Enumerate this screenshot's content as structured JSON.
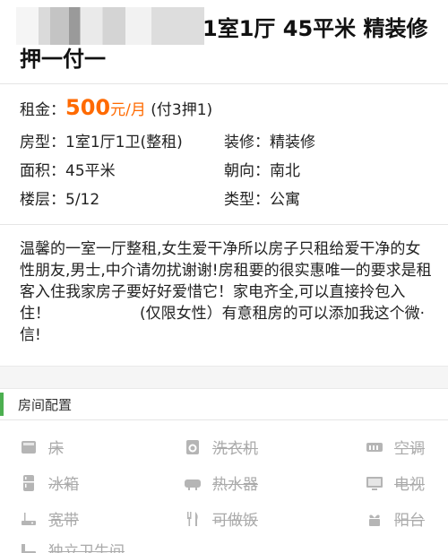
{
  "title": {
    "line1_visible": "1室1厅 45平米 精装修",
    "line2": "押一付一"
  },
  "price": {
    "label": "租金：",
    "amount": "500",
    "unit": "元/月",
    "terms": " (付3押1)"
  },
  "details": {
    "layout_label": "房型：",
    "layout_value": "1室1厅1卫(整租)",
    "decor_label": "装修：",
    "decor_value": "精装修",
    "area_label": "面积：",
    "area_value": "45平米",
    "orient_label": "朝向：",
    "orient_value": "南北",
    "floor_label": "楼层：",
    "floor_value": "5/12",
    "type_label": "类型：",
    "type_value": "公寓"
  },
  "description": {
    "part1": "温馨的一室一厅整租,女生爱干净所以房子只租给爱干净的女性朋友,男士,中介请勿扰谢谢!房租要的很实惠唯一的要求是租客入住我家房子要好好爱惜它！家电齐全,可以直接拎包入住！",
    "part2": "(仅限女性）有意租房的可以添加我这个微·信!"
  },
  "facilities": {
    "section_title": "房间配置",
    "items": [
      {
        "label": "床",
        "icon": "bed-icon"
      },
      {
        "label": "洗衣机",
        "icon": "washer-icon"
      },
      {
        "label": "空调",
        "icon": "air-conditioner-icon"
      },
      {
        "label": "冰箱",
        "icon": "fridge-icon"
      },
      {
        "label": "热水器",
        "icon": "water-heater-icon"
      },
      {
        "label": "电视",
        "icon": "tv-icon"
      },
      {
        "label": "宽带",
        "icon": "router-icon"
      },
      {
        "label": "可做饭",
        "icon": "cutlery-icon"
      },
      {
        "label": "阳台",
        "icon": "balcony-icon"
      },
      {
        "label": "独立卫生间",
        "icon": "bathroom-icon"
      }
    ]
  },
  "colors": {
    "price": "#ff6a00",
    "accent_bar": "#4caf50",
    "disabled_text": "#aaaaaa"
  }
}
